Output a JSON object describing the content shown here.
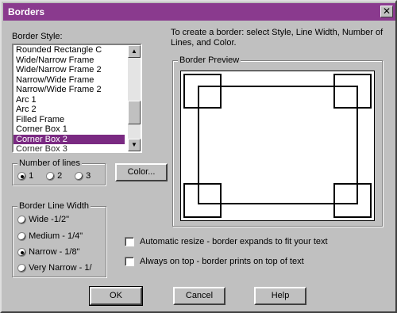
{
  "window": {
    "title": "Borders",
    "close_label": "✕"
  },
  "instructions": "To create a border: select Style, Line Width,  Number of Lines, and Color.",
  "border_style": {
    "label": "Border Style:",
    "items": [
      "Rounded Rectangle C",
      "Wide/Narrow Frame",
      "Wide/Narrow Frame 2",
      "Narrow/Wide Frame",
      "Narrow/Wide Frame 2",
      "Arc 1",
      "Arc 2",
      "Filled Frame",
      "Corner Box 1",
      "Corner Box 2",
      "Corner Box 3"
    ],
    "selected": "Corner Box 2"
  },
  "number_of_lines": {
    "label": "Number of lines",
    "options": [
      "1",
      "2",
      "3"
    ],
    "selected": "1"
  },
  "color_button": "Color...",
  "border_preview": {
    "label": "Border Preview"
  },
  "line_width": {
    "label": "Border Line Width",
    "options": [
      "Wide -1/2\"",
      "Medium - 1/4\"",
      "Narrow - 1/8\"",
      "Very Narrow - 1/"
    ],
    "selected": "Narrow - 1/8\""
  },
  "options": {
    "auto_resize": {
      "label": "Automatic resize - border expands to fit your text",
      "checked": false
    },
    "always_on_top": {
      "label": "Always on top - border prints on top of text",
      "checked": false
    }
  },
  "buttons": {
    "ok": "OK",
    "cancel": "Cancel",
    "help": "Help"
  },
  "colors": {
    "titlebar": "#8a3a8e",
    "selection": "#7a2a82",
    "face": "#c0c0c0"
  }
}
